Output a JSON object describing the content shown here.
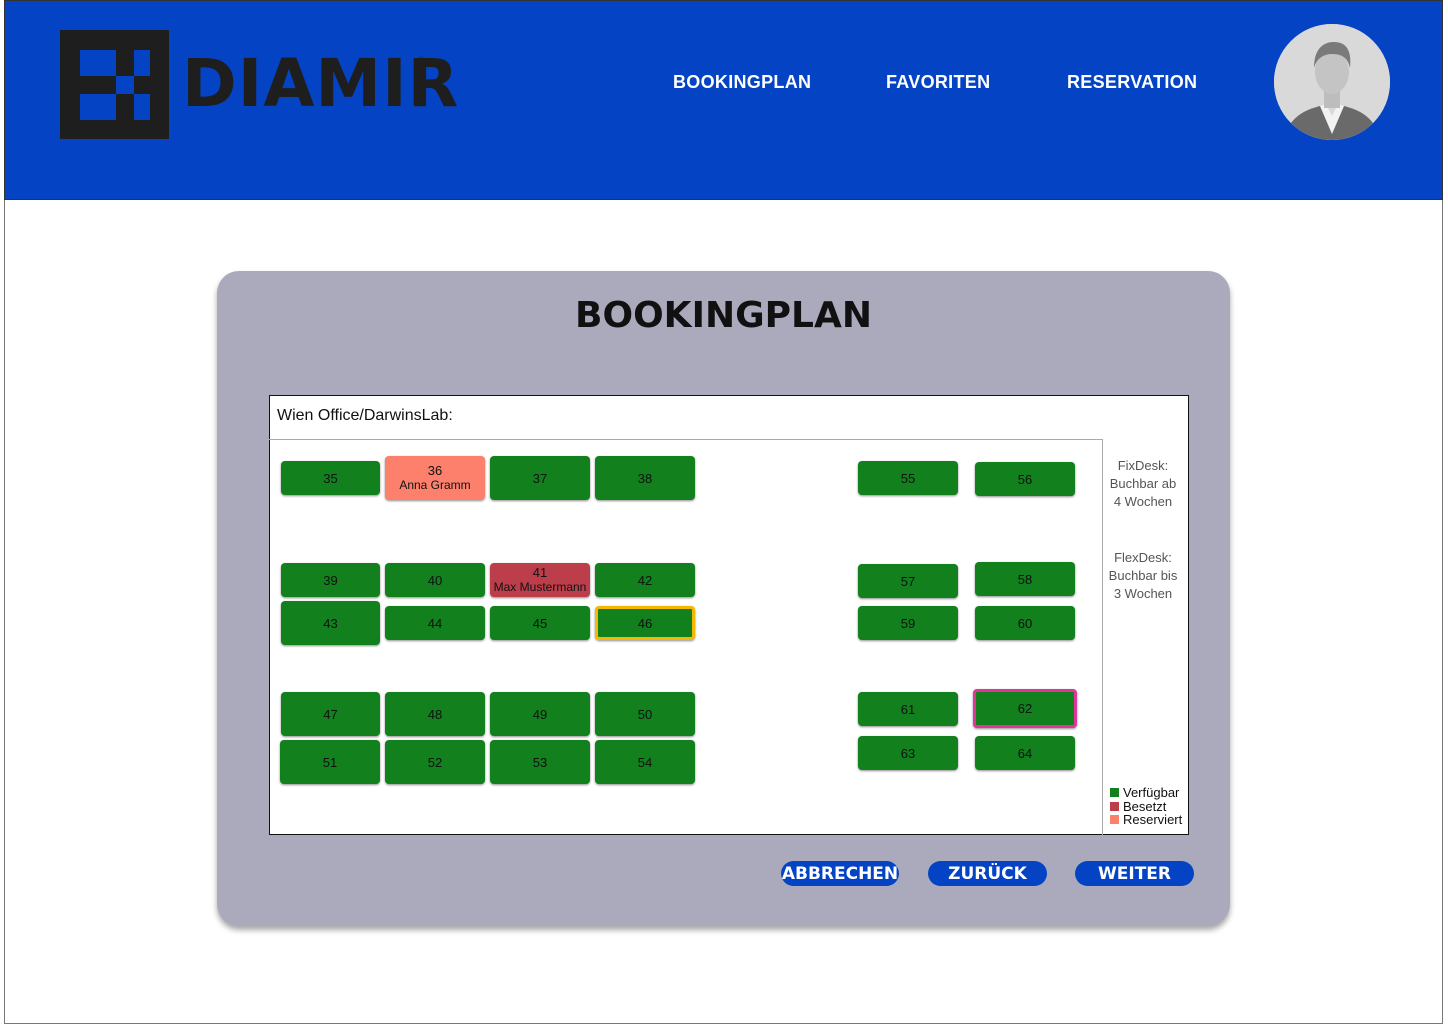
{
  "brand": {
    "name": "DIAMIR",
    "registered": "®"
  },
  "nav": [
    {
      "label": "BOOKINGPLAN"
    },
    {
      "label": "FAVORITEN"
    },
    {
      "label": "RESERVATION"
    }
  ],
  "panel": {
    "title": "BOOKINGPLAN",
    "office": "Wien Office/DarwinsLab:"
  },
  "desks": [
    {
      "number": "35",
      "status": "available"
    },
    {
      "number": "36",
      "status": "reserved",
      "occupant": "Anna Gramm"
    },
    {
      "number": "37",
      "status": "available"
    },
    {
      "number": "38",
      "status": "available"
    },
    {
      "number": "39",
      "status": "available"
    },
    {
      "number": "40",
      "status": "available"
    },
    {
      "number": "41",
      "status": "occupied",
      "occupant": "Max Mustermann"
    },
    {
      "number": "42",
      "status": "available"
    },
    {
      "number": "43",
      "status": "available"
    },
    {
      "number": "44",
      "status": "available"
    },
    {
      "number": "45",
      "status": "available"
    },
    {
      "number": "46",
      "status": "available",
      "highlight": "yellow"
    },
    {
      "number": "47",
      "status": "available"
    },
    {
      "number": "48",
      "status": "available"
    },
    {
      "number": "49",
      "status": "available"
    },
    {
      "number": "50",
      "status": "available"
    },
    {
      "number": "51",
      "status": "available"
    },
    {
      "number": "52",
      "status": "available"
    },
    {
      "number": "53",
      "status": "available"
    },
    {
      "number": "54",
      "status": "available"
    },
    {
      "number": "55",
      "status": "available"
    },
    {
      "number": "56",
      "status": "available"
    },
    {
      "number": "57",
      "status": "available"
    },
    {
      "number": "58",
      "status": "available"
    },
    {
      "number": "59",
      "status": "available"
    },
    {
      "number": "60",
      "status": "available"
    },
    {
      "number": "61",
      "status": "available"
    },
    {
      "number": "62",
      "status": "available",
      "highlight": "pink"
    },
    {
      "number": "63",
      "status": "available"
    },
    {
      "number": "64",
      "status": "available"
    }
  ],
  "notes": {
    "fixdesk": [
      "FixDesk:",
      "Buchbar ab",
      "4 Wochen"
    ],
    "flexdesk": [
      "FlexDesk:",
      "Buchbar bis",
      "3 Wochen"
    ]
  },
  "legend": [
    {
      "label": "Verfügbar",
      "color": "#11801d"
    },
    {
      "label": "Besetzt",
      "color": "#bc3e4a"
    },
    {
      "label": "Reserviert",
      "color": "#fc806c"
    }
  ],
  "buttons": {
    "cancel": "ABBRECHEN",
    "back": "ZURÜCK",
    "next": "WEITER"
  },
  "colors": {
    "header": "#0444c4",
    "panel": "#abaabc",
    "available": "#11801d",
    "occupied": "#bc3e4a",
    "reserved": "#fc806c"
  }
}
